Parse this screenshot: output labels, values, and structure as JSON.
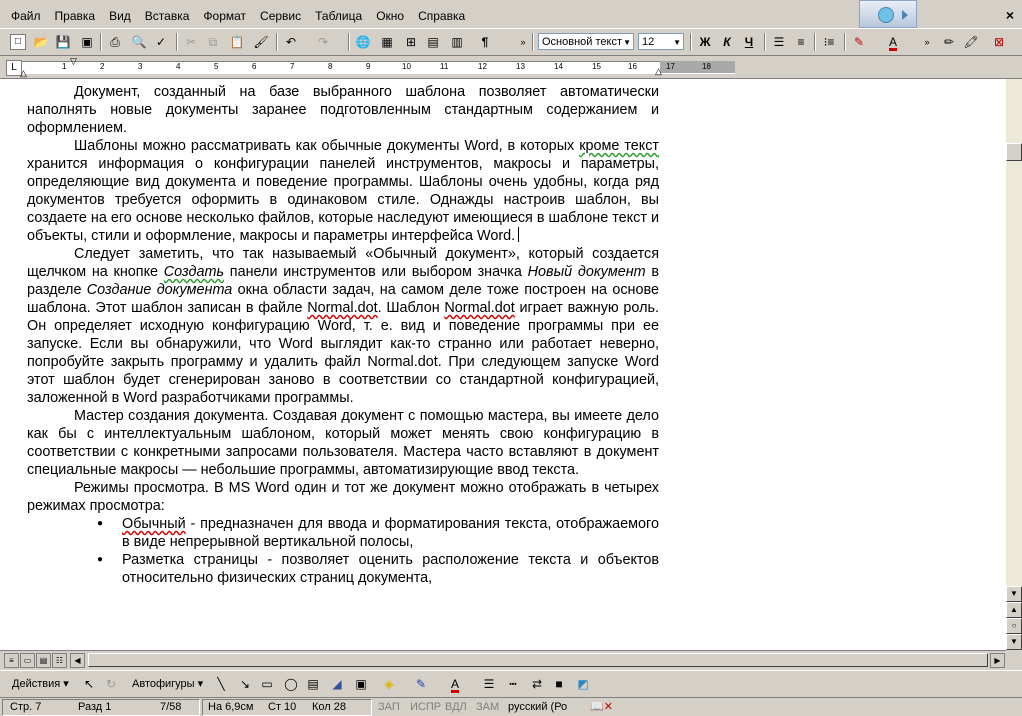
{
  "menu": {
    "items": [
      "Файл",
      "Правка",
      "Вид",
      "Вставка",
      "Формат",
      "Сервис",
      "Таблица",
      "Окно",
      "Справка"
    ],
    "close_glyph": "×"
  },
  "toolbar": {
    "style_value": "Основной текст",
    "size_value": "12",
    "bold": "Ж",
    "italic": "К",
    "underline": "Ч",
    "pilcrow": "¶"
  },
  "ruler": {
    "tab_selector": "L",
    "numbers": [
      "1",
      "2",
      "3",
      "4",
      "5",
      "6",
      "7",
      "8",
      "9",
      "10",
      "11",
      "12",
      "13",
      "14",
      "15",
      "16",
      "17",
      "18"
    ]
  },
  "document": {
    "p1": "Документ, созданный на базе выбранного шаблона позволяет автоматически наполнять новые документы заранее подготовленным стандартным содержанием и оформлением.",
    "p2_a": "Шаблоны можно рассматривать как обычные документы Word, в которых ",
    "p2_b": "кроме текст",
    "p2_c": " хранится информация о конфигурации панелей инструментов, макросы и параметры, определяющие вид документа и поведение программы. Шаблоны очень удобны, когда ряд документов требуется оформить в одинаковом стиле. Однажды настроив шаблон, вы создаете на его основе несколько файлов, которые наследуют имеющиеся в шаблоне текст и объекты, стили и оформление, макросы и параметры интерфейса Word.",
    "p3_a": "Следует заметить, что так называемый «Обычный документ», который создается щелчком на кнопке ",
    "p3_b": "Создать",
    "p3_c": " панели инструментов или выбором значка ",
    "p3_d": "Новый документ",
    "p3_e": " в разделе ",
    "p3_f": "Создание документа",
    "p3_g": " окна области задач, на самом деле тоже построен на основе шаблона. Этот шаблон записан в файле ",
    "p3_h": "Normal.dot",
    "p3_i": ". Шаблон ",
    "p3_j": "Normal.dot",
    "p3_k": " играет важную роль. Он определяет исходную конфигурацию Word, т. е. вид и поведение программы при ее запуске. Если вы обнаружили, что Word выглядит как-то странно или работает неверно, попробуйте закрыть программу и удалить файл Normal.dot. При следующем запуске Word этот шаблон будет сгенерирован заново в соответствии со стандартной конфигурацией, заложенной в Word разработчиками программы.",
    "p4": "Мастер создания документа. Создавая документ с помощью мастера, вы имеете дело как бы с интеллектуальным шаблоном, который может менять свою конфигурацию в соответствии с конкретными запросами пользователя. Мастера часто вставляют в документ специальные макросы — небольшие программы, автоматизирующие ввод текста.",
    "p5": "Режимы просмотра. В MS Word один и тот же документ можно отображать в четырех режимах просмотра:",
    "b1_a": "Обычный",
    "b1_b": " - предназначен для ввода и форматирования текста, отображаемого в виде непрерывной вертикальной полосы,",
    "b2": "Разметка страницы - позволяет оценить расположение текста и объектов относительно физических страниц документа,"
  },
  "drawbar": {
    "actions": "Действия ▾",
    "autoshapes": "Автофигуры ▾"
  },
  "status": {
    "page": "Стр. 7",
    "section": "Разд 1",
    "pages": "7/58",
    "at": "На 6,9см",
    "line": "Ст 10",
    "col": "Кол 28",
    "rec": "ЗАП",
    "trk": "ИСПР",
    "ext": "ВДЛ",
    "ovr": "ЗАМ",
    "lang": "русский (Ро"
  }
}
